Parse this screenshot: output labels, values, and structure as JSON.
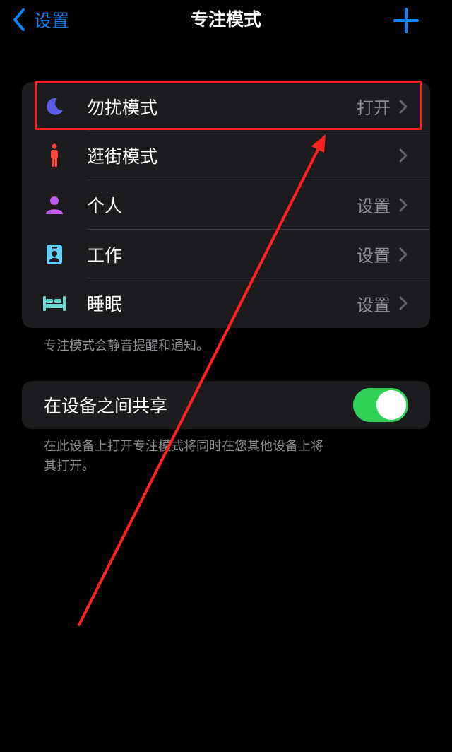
{
  "navbar": {
    "back_label": "设置",
    "title": "专注模式"
  },
  "focus_modes": [
    {
      "label": "勿扰模式",
      "value": "打开",
      "icon": "moon-icon",
      "icon_color": "#5e5ce6"
    },
    {
      "label": "逛街模式",
      "value": "",
      "icon": "person-walking-icon",
      "icon_color": "#ff453a"
    },
    {
      "label": "个人",
      "value": "设置",
      "icon": "person-icon",
      "icon_color": "#bf5af2"
    },
    {
      "label": "工作",
      "value": "设置",
      "icon": "id-badge-icon",
      "icon_color": "#64d2ff"
    },
    {
      "label": "睡眠",
      "value": "设置",
      "icon": "bed-icon",
      "icon_color": "#66d4cf"
    }
  ],
  "focus_footnote": "专注模式会静音提醒和通知。",
  "share": {
    "label": "在设备之间共享",
    "enabled": true,
    "footnote_line1": "在此设备上打开专注模式将同时在您其他设备上将",
    "footnote_line2": "其打开。"
  },
  "colors": {
    "accent": "#0a84ff",
    "toggle_on": "#30d158",
    "annotation": "#ff2020"
  }
}
